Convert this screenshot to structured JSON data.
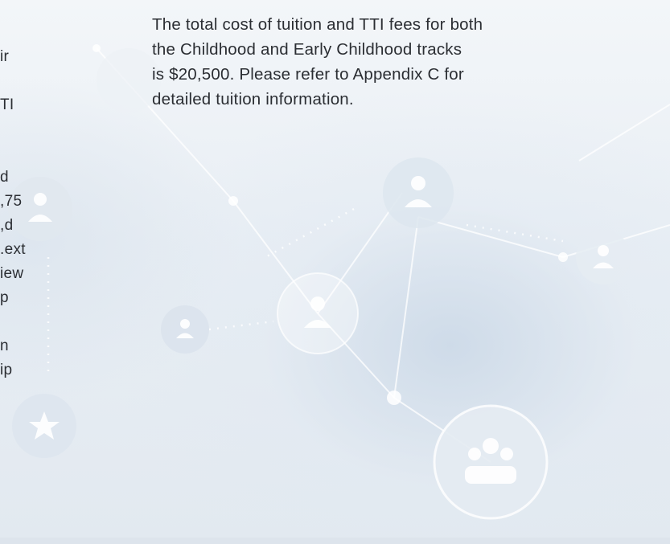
{
  "paragraph": {
    "lines": [
      "The total cost of tuition and TTI fees for both",
      "the Childhood and Early Childhood tracks",
      "is $20,500. Please refer to Appendix C for",
      "detailed tuition information."
    ]
  },
  "left_column_fragments": {
    "lines": [
      "ir",
      "",
      "TI",
      "",
      "",
      "d",
      "75,",
      "d,",
      "ext.",
      "iew",
      "p",
      "",
      "n",
      "ip"
    ]
  },
  "background": {
    "icons": [
      "person-icon",
      "group-icon",
      "star-icon"
    ],
    "accent": "#c9d6e4"
  }
}
